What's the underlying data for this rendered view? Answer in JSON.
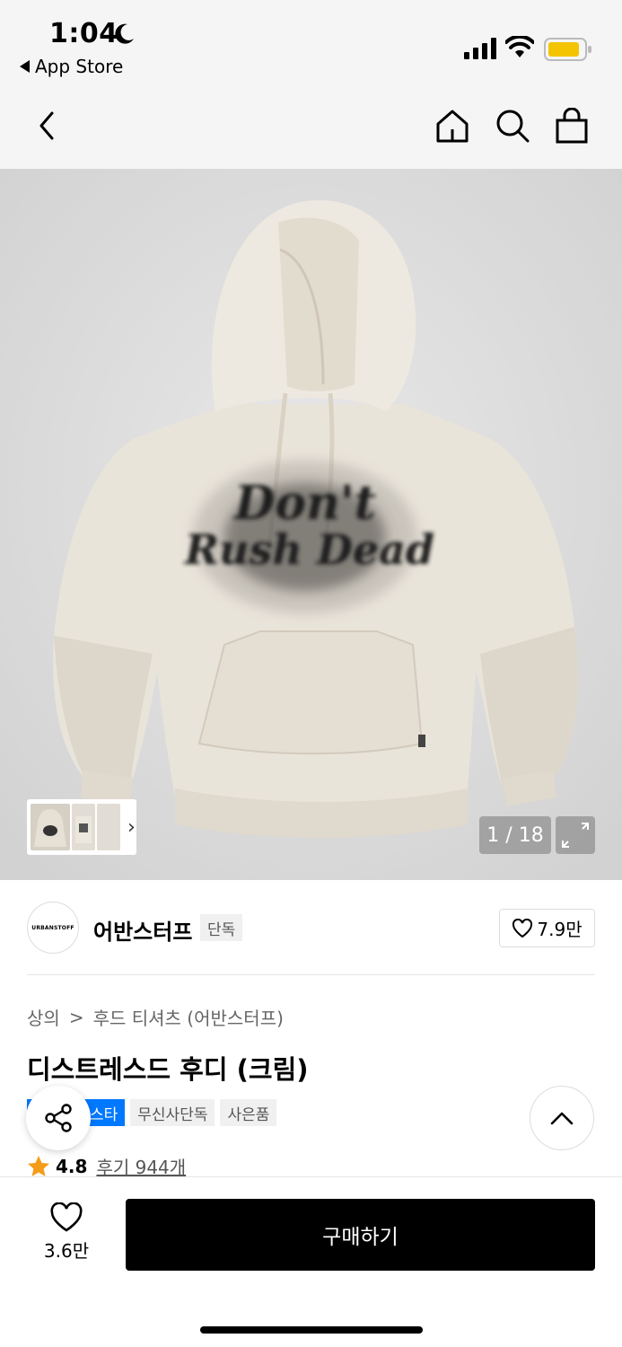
{
  "status_bar": {
    "time": "1:04",
    "back_app_label": "App Store",
    "icons": [
      "moon-icon",
      "signal-icon",
      "wifi-icon",
      "battery-icon"
    ],
    "battery_color": "#f5c400"
  },
  "nav": {
    "icons": [
      "back-icon",
      "home-icon",
      "search-icon",
      "bag-icon"
    ]
  },
  "gallery": {
    "page_counter": "1 / 18",
    "current_page": 1,
    "total_pages": 18,
    "graphic_text": "Don't Rush Dead",
    "expand_icon": "expand-icon",
    "thumbnail_arrow": "›"
  },
  "brand": {
    "logo_text": "URBANSTOFF",
    "name": "어반스터프",
    "badge": "단독",
    "like_count": "7.9만"
  },
  "breadcrumb": {
    "category": "상의",
    "separator": ">",
    "subcategory": "후드 티셔츠 (어반스터프)"
  },
  "product": {
    "title": "디스트레스드 후디 (크림)",
    "tags": [
      "스타",
      "무신사단독",
      "사은품"
    ],
    "rating": "4.8",
    "reviews": "후기 944개"
  },
  "bottom_bar": {
    "like_count": "3.6만",
    "buy_label": "구매하기"
  },
  "colors": {
    "accent_blue": "#0078ff",
    "star": "#f59c1a",
    "buy_button": "#000000"
  }
}
